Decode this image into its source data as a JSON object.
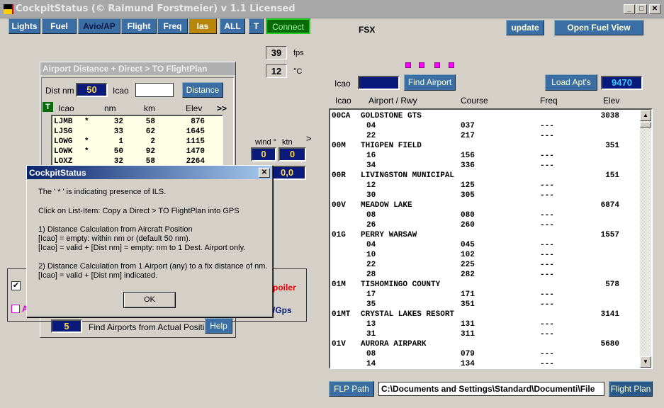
{
  "window": {
    "title": "CockpitStatus (© Raimund Forstmeier) v 1.1 Licensed",
    "min": "_",
    "max": "□",
    "close": "✕"
  },
  "tabs": [
    {
      "label": "Lights"
    },
    {
      "label": "Fuel"
    },
    {
      "label": "Avio/AP"
    },
    {
      "label": "Flight"
    },
    {
      "label": "Freq"
    },
    {
      "label": "Ias"
    },
    {
      "label": "ALL"
    },
    {
      "label": "T"
    },
    {
      "label": "Connect"
    }
  ],
  "colors": {
    "tab": "#3a6ea5",
    "active_tab": "#b8860b",
    "connect": "#0a6a0a",
    "field": "#0a1a7a",
    "accent_text": "#ffd84a"
  },
  "sim": "FSX",
  "update_label": "update",
  "open_fuel_view_label": "Open Fuel View",
  "fps": {
    "value": "39",
    "unit": "fps"
  },
  "temp": {
    "value": "12",
    "unit": "°C"
  },
  "wind": {
    "label": "wind °",
    "ktn_label": "ktn",
    "dir": "0",
    "speed": "0",
    "arrow": ">",
    "extra": "0,0"
  },
  "dist_panel": {
    "title": "Airport Distance + Direct > TO  FlightPlan",
    "dist_label": "Dist nm",
    "dist_value": "50",
    "icao_label": "Icao",
    "icao_value": "",
    "distance_button": "Distance",
    "t_badge": "T",
    "headers": [
      "Icao",
      "nm",
      "km",
      "Elev",
      ">>"
    ],
    "rows": [
      [
        "LJMB",
        "*",
        "32",
        "58",
        "876"
      ],
      [
        "LJSG",
        "",
        "33",
        "62",
        "1645"
      ],
      [
        "LOWG",
        "*",
        "1",
        "2",
        "1115"
      ],
      [
        "LOWK",
        "*",
        "50",
        "92",
        "1470"
      ],
      [
        "LOXZ",
        "",
        "32",
        "58",
        "2264"
      ]
    ],
    "count": "5",
    "find_label": "Find Airports from Actual Position",
    "help_button": "Help"
  },
  "bg_partial": {
    "spoiler": "poiler",
    "gps": "/Gps",
    "pink_label": "A"
  },
  "dialog": {
    "title": "CockpitStatus",
    "close": "✕",
    "lines": [
      "The ' * ' is indicating presence of ILS.",
      "Click on List-Item: Copy a Direct > TO  FlightPlan into GPS",
      "1) Distance Calculation from Aircraft Position",
      "[Icao] = empty: within nm or (default 50 nm).",
      "[Icao] = valid + [Dist nm] = empty: nm to 1 Dest. Airport only.",
      "2) Distance Calculation from 1 Airport (any) to a fix distance of nm.",
      "[Icao] = valid + [Dist nm] indicated."
    ],
    "ok": "OK"
  },
  "airport_search": {
    "icao_label": "Icao",
    "icao_value": "",
    "find_button": "Find Airport",
    "load_button": "Load Apt's",
    "count": "9470",
    "headers": [
      "Icao",
      "Airport / Rwy",
      "Course",
      "Freq",
      "Elev"
    ],
    "airports": [
      {
        "icao": "00CA",
        "name": "GOLDSTONE GTS",
        "elev": "3038",
        "rwys": [
          [
            "04",
            "037",
            "---"
          ],
          [
            "22",
            "217",
            "---"
          ]
        ]
      },
      {
        "icao": "00M",
        "name": "THIGPEN FIELD",
        "elev": "351",
        "rwys": [
          [
            "16",
            "156",
            "---"
          ],
          [
            "34",
            "336",
            "---"
          ]
        ]
      },
      {
        "icao": "00R",
        "name": "LIVINGSTON MUNICIPAL",
        "elev": "151",
        "rwys": [
          [
            "12",
            "125",
            "---"
          ],
          [
            "30",
            "305",
            "---"
          ]
        ]
      },
      {
        "icao": "00V",
        "name": "MEADOW LAKE",
        "elev": "6874",
        "rwys": [
          [
            "08",
            "080",
            "---"
          ],
          [
            "26",
            "260",
            "---"
          ]
        ]
      },
      {
        "icao": "01G",
        "name": "PERRY WARSAW",
        "elev": "1557",
        "rwys": [
          [
            "04",
            "045",
            "---"
          ],
          [
            "10",
            "102",
            "---"
          ],
          [
            "22",
            "225",
            "---"
          ],
          [
            "28",
            "282",
            "---"
          ]
        ]
      },
      {
        "icao": "01M",
        "name": "TISHOMINGO COUNTY",
        "elev": "578",
        "rwys": [
          [
            "17",
            "171",
            "---"
          ],
          [
            "35",
            "351",
            "---"
          ]
        ]
      },
      {
        "icao": "01MT",
        "name": "CRYSTAL LAKES RESORT",
        "elev": "3141",
        "rwys": [
          [
            "13",
            "131",
            "---"
          ],
          [
            "31",
            "311",
            "---"
          ]
        ]
      },
      {
        "icao": "01V",
        "name": "AURORA AIRPARK",
        "elev": "5680",
        "rwys": [
          [
            "08",
            "079",
            "---"
          ],
          [
            "14",
            "134",
            "---"
          ]
        ]
      }
    ]
  },
  "flp": {
    "path_button": "FLP Path",
    "path_value": "C:\\Documents and Settings\\Standard\\Documenti\\File",
    "flight_plan_button": "Flight Plan"
  }
}
